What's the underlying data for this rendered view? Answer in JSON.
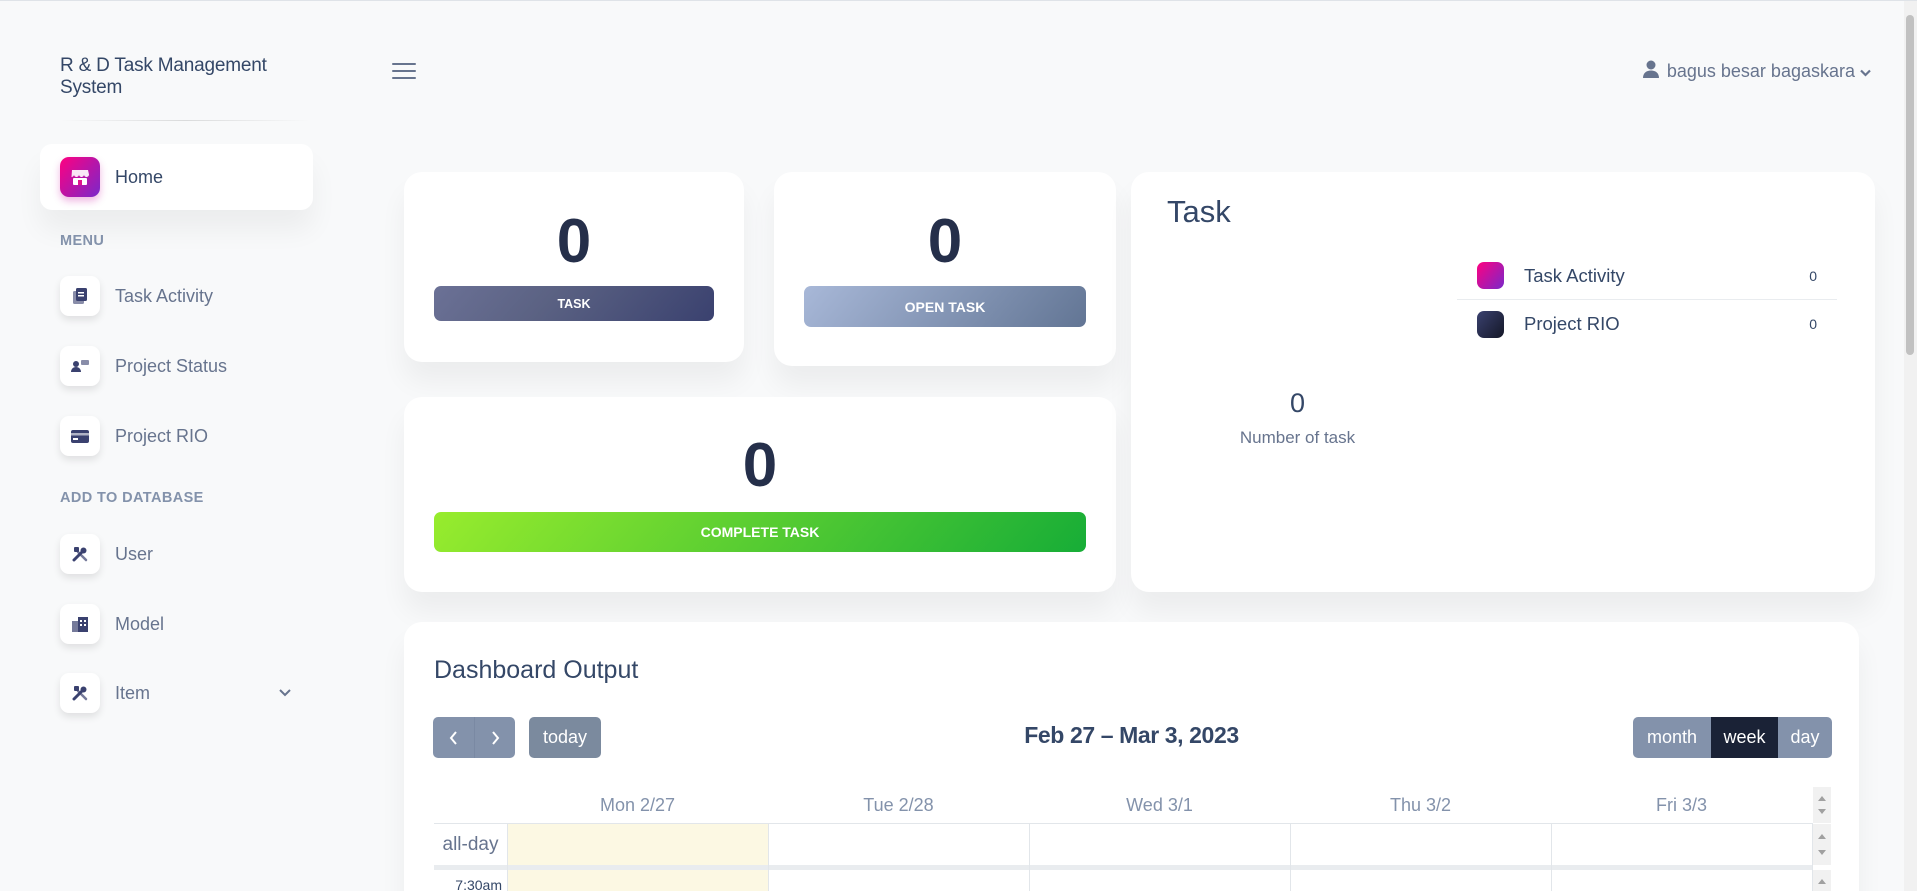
{
  "app": {
    "title": "R & D Task Management System"
  },
  "sidebar": {
    "home_label": "Home",
    "menu_heading": "MENU",
    "menu_items": [
      {
        "label": "Task Activity",
        "icon": "document-icon"
      },
      {
        "label": "Project Status",
        "icon": "user-card-icon"
      },
      {
        "label": "Project RIO",
        "icon": "credit-card-icon"
      }
    ],
    "db_heading": "ADD TO DATABASE",
    "db_items": [
      {
        "label": "User",
        "icon": "tools-icon"
      },
      {
        "label": "Model",
        "icon": "building-icon"
      },
      {
        "label": "Item",
        "icon": "tools-icon"
      }
    ]
  },
  "navbar": {
    "user_name": "bagus besar bagaskara"
  },
  "stats": {
    "task": {
      "value": "0",
      "label": "TASK"
    },
    "open_task": {
      "value": "0",
      "label": "OPEN TASK"
    },
    "complete_task": {
      "value": "0",
      "label": "COMPLETE TASK"
    }
  },
  "task_card": {
    "title": "Task",
    "center_value": "0",
    "center_label": "Number of task",
    "legend": [
      {
        "name": "Task Activity",
        "value": "0",
        "color": "#cb0c9f"
      },
      {
        "name": "Project RIO",
        "value": "0",
        "color": "#252f4a"
      }
    ]
  },
  "calendar": {
    "title": "Dashboard Output",
    "prev_icon": "chevron-left-icon",
    "next_icon": "chevron-right-icon",
    "today_label": "today",
    "range": "Feb 27 – Mar 3, 2023",
    "views": {
      "month": "month",
      "week": "week",
      "day": "day"
    },
    "active_view": "week",
    "days": [
      "Mon 2/27",
      "Tue 2/28",
      "Wed 3/1",
      "Thu 3/2",
      "Fri 3/3"
    ],
    "allday_label": "all-day",
    "first_slot": "7:30am",
    "today_color": "#fcf8e3"
  },
  "colors": {
    "accent_pink": "#cb0c9f",
    "dark": "#252f4a",
    "task_bar": "#5b6283",
    "open_task_bar": "#a3b4cf",
    "complete_task_bar": "#82d616"
  }
}
